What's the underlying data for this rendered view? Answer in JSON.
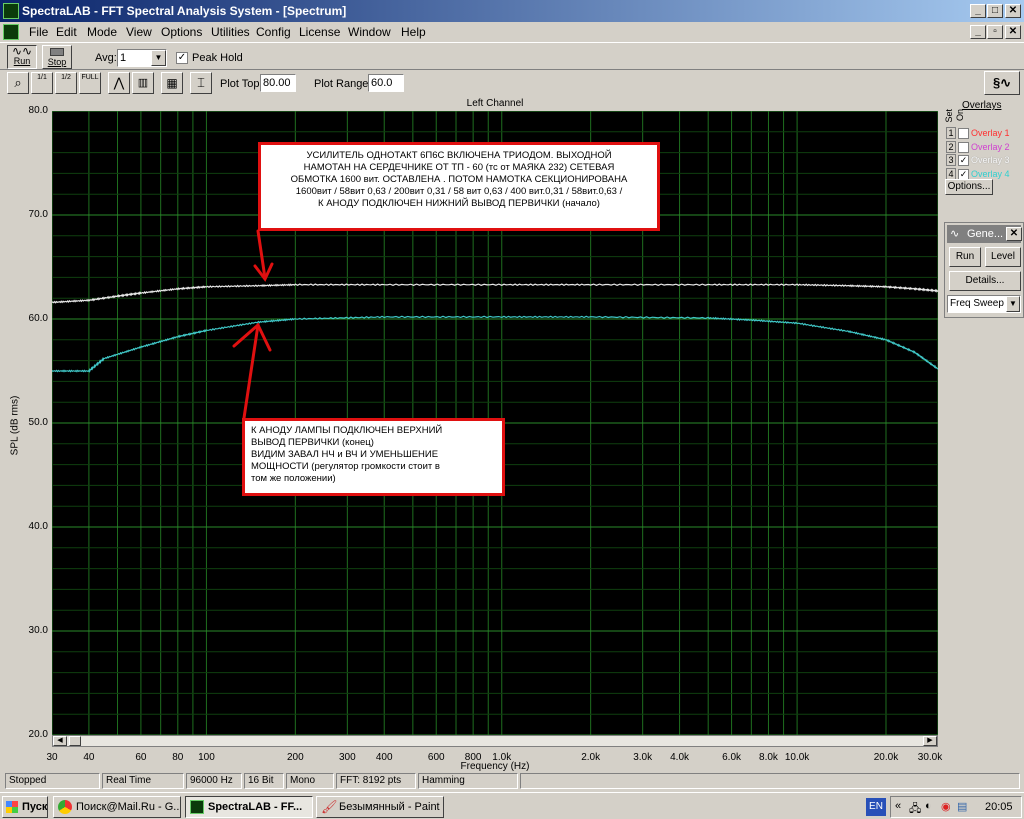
{
  "window": {
    "title": "SpectraLAB - FFT Spectral Analysis System - [Spectrum]"
  },
  "menu": [
    "File",
    "Edit",
    "Mode",
    "View",
    "Options",
    "Utilities",
    "Config",
    "License",
    "Window",
    "Help"
  ],
  "toolbar": {
    "run_label": "Run",
    "stop_label": "Stop",
    "avg_label": "Avg:",
    "avg_value": "1",
    "peak_hold_label": "Peak Hold",
    "plot_top_label": "Plot Top:",
    "plot_top_value": "80.00",
    "plot_range_label": "Plot Range:",
    "plot_range_value": "60.0",
    "icons": [
      "zoom-icon",
      "octave-1-icon",
      "octave-2-icon",
      "octave-3-icon",
      "line-graph-icon",
      "bar-graph-icon",
      "calculator-icon",
      "cursor-icon"
    ],
    "octave_btns": [
      "1/1",
      "1/2",
      "1/3",
      "FULL"
    ]
  },
  "overlays": {
    "title": "Overlays",
    "set_label": "Set",
    "on_label": "On",
    "items": [
      {
        "num": "1",
        "label": "Overlay 1",
        "checked": false,
        "color": "#ff3030"
      },
      {
        "num": "2",
        "label": "Overlay 2",
        "checked": false,
        "color": "#d040d0"
      },
      {
        "num": "3",
        "label": "Overlay 3",
        "checked": true,
        "color": "#ffffff"
      },
      {
        "num": "4",
        "label": "Overlay 4",
        "checked": true,
        "color": "#30d0d0"
      }
    ],
    "options_label": "Options..."
  },
  "generator": {
    "title": "Gene...",
    "run_label": "Run",
    "level_label": "Level",
    "details_label": "Details...",
    "mode_value": "Freq Sweep"
  },
  "annotations": {
    "top": [
      "УСИЛИТЕЛЬ  ОДНОТАКТ 6П6С ВКЛЮЧЕНА ТРИОДОМ.  ВЫХОДНОЙ",
      "НАМОТАН  НА  СЕРДЕЧНИКЕ  ОТ  ТП - 60  (тс  от  МАЯКА  232)  СЕТЕВАЯ",
      "ОБМОТКА  1600 вит. ОСТАВЛЕНА . ПОТОМ  НАМОТКА  СЕКЦИОНИРОВАНА",
      "1600вит / 58вит 0,63 / 200вит 0,31 / 58 вит 0,63 / 400 вит.0,31 / 58вит.0,63 /",
      "К  АНОДУ  ПОДКЛЮЧЕН  НИЖНИЙ  ВЫВОД  ПЕРВИЧКИ  (начало)"
    ],
    "bottom": [
      "К  АНОДУ  ЛАМПЫ  ПОДКЛЮЧЕН  ВЕРХНИЙ",
      "ВЫВОД   ПЕРВИЧКИ  (конец)",
      "ВИДИМ  ЗАВАЛ  НЧ и ВЧ  И  УМЕНЬШЕНИЕ",
      "МОЩНОСТИ  (регулятор  громкости  стоит  в",
      "том же положении)"
    ],
    "color": "#e01010"
  },
  "status": [
    "Stopped",
    "Real Time",
    "96000 Hz",
    "16 Bit",
    "Mono",
    "FFT: 8192 pts",
    "Hamming"
  ],
  "taskbar": {
    "start_label": "Пуск",
    "tasks": [
      "Поиск@Mail.Ru - G...",
      "SpectraLAB - FF...",
      "Безымянный - Paint"
    ],
    "lang": "EN",
    "clock": "20:05"
  },
  "chart_data": {
    "type": "line",
    "title": "Left Channel",
    "xlabel": "Frequency (Hz)",
    "ylabel": "SPL (dB rms)",
    "x_scale": "log",
    "xlim": [
      30,
      30000
    ],
    "ylim": [
      20,
      80
    ],
    "yticks": [
      "80.0",
      "70.0",
      "60.0",
      "50.0",
      "40.0",
      "30.0",
      "20.0"
    ],
    "ytick_values": [
      80,
      70,
      60,
      50,
      40,
      30,
      20
    ],
    "xticks": [
      "30",
      "40",
      "60",
      "80",
      "100",
      "200",
      "300",
      "400",
      "600",
      "800",
      "1.0k",
      "2.0k",
      "3.0k",
      "4.0k",
      "6.0k",
      "8.0k",
      "10.0k",
      "20.0k",
      "30.0k"
    ],
    "xtick_values": [
      30,
      40,
      60,
      80,
      100,
      200,
      300,
      400,
      600,
      800,
      1000,
      2000,
      3000,
      4000,
      6000,
      8000,
      10000,
      20000,
      30000
    ],
    "grid": true,
    "series": [
      {
        "color": "#e8e8e8",
        "x": [
          30,
          40,
          50,
          60,
          80,
          100,
          150,
          200,
          400,
          1000,
          2000,
          5000,
          10000,
          15000,
          20000,
          25000,
          30000
        ],
        "y": [
          61.6,
          61.8,
          62.2,
          62.5,
          62.9,
          63.1,
          63.2,
          63.3,
          63.3,
          63.3,
          63.3,
          63.3,
          63.3,
          63.2,
          63.1,
          62.9,
          62.7
        ]
      },
      {
        "color": "#40c8c8",
        "x": [
          30,
          40,
          45,
          60,
          80,
          100,
          150,
          200,
          400,
          1000,
          2000,
          5000,
          7000,
          10000,
          15000,
          20000,
          25000,
          30000
        ],
        "y": [
          55.0,
          55.0,
          56.2,
          57.3,
          58.3,
          58.9,
          59.7,
          60.0,
          60.2,
          60.2,
          60.2,
          60.1,
          59.9,
          59.6,
          58.8,
          58.0,
          56.8,
          55.2
        ]
      }
    ]
  }
}
